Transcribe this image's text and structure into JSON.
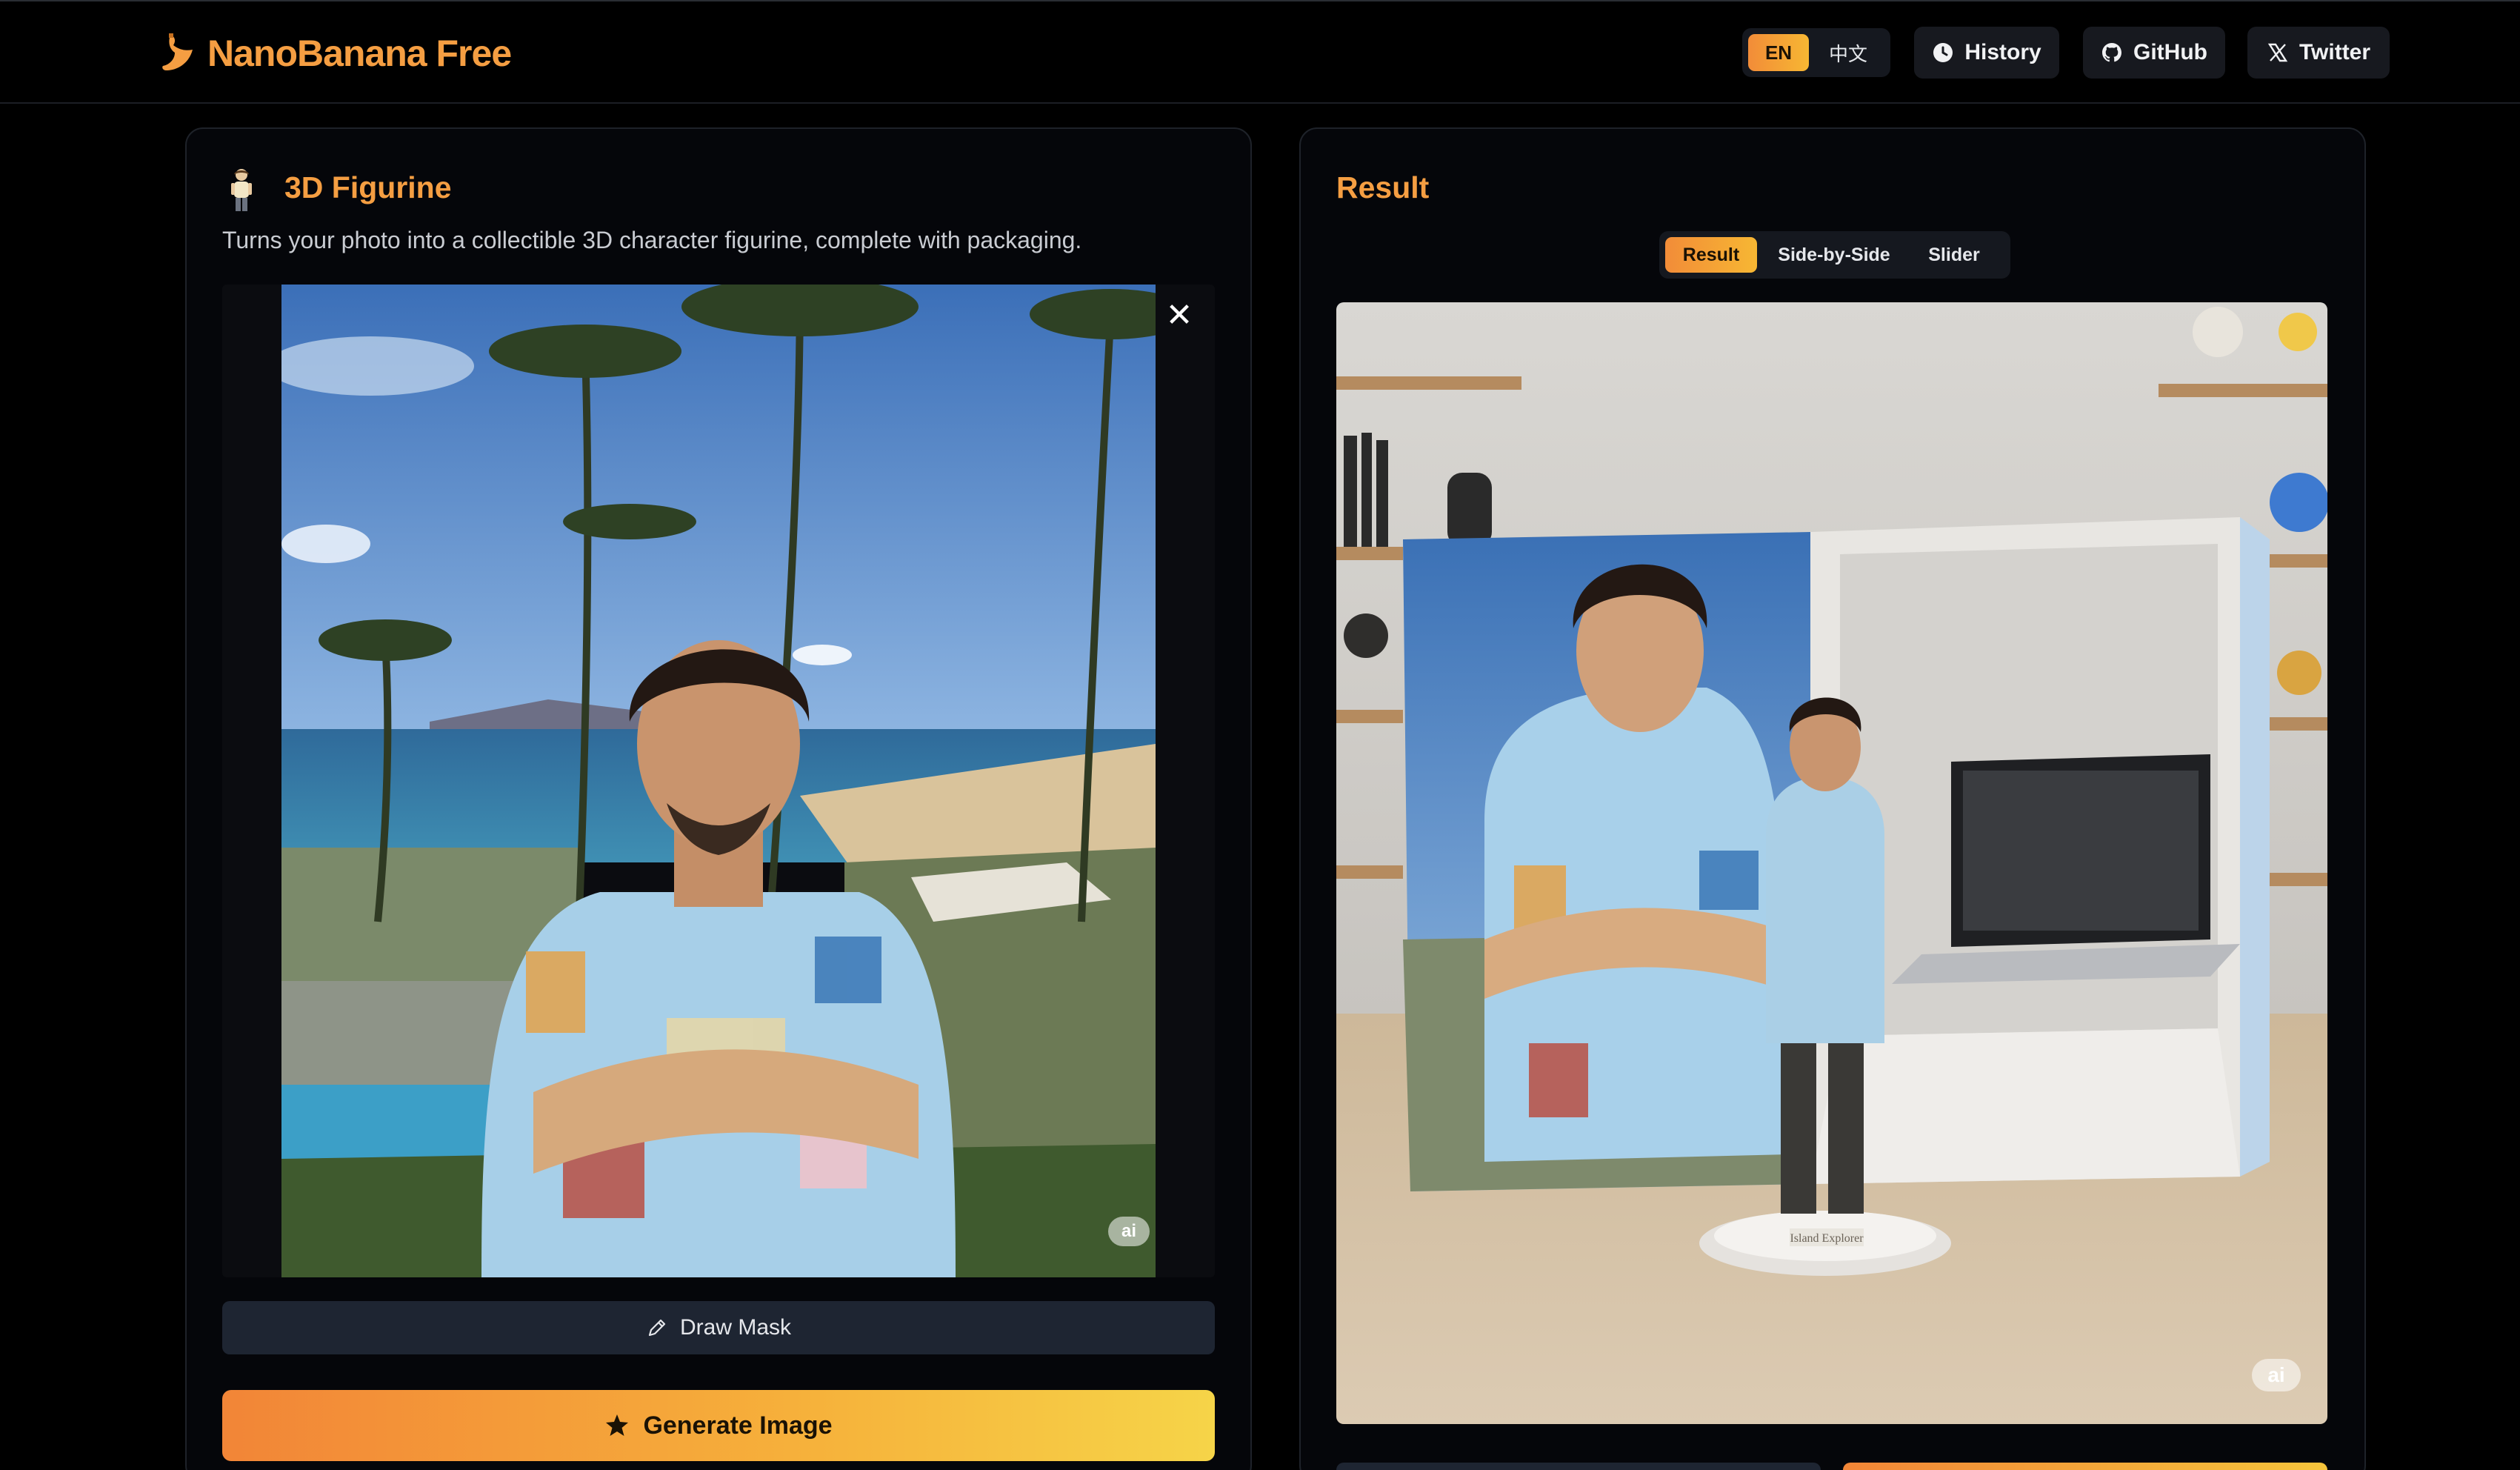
{
  "header": {
    "brand": "NanoBanana Free",
    "lang_active": "EN",
    "lang_other": "中文",
    "history_label": "History",
    "github_label": "GitHub",
    "twitter_label": "Twitter"
  },
  "transform": {
    "title": "3D Figurine",
    "description": "Turns your photo into a collectible 3D character figurine, complete with packaging.",
    "draw_mask_label": "Draw Mask",
    "generate_label": "Generate Image",
    "close_symbol": "✕",
    "watermark": "ai"
  },
  "result": {
    "title": "Result",
    "tabs": [
      {
        "label": "Result",
        "active": true
      },
      {
        "label": "Side-by-Side",
        "active": false
      },
      {
        "label": "Slider",
        "active": false
      }
    ],
    "stand_plaque": "Island Explorer",
    "watermark": "ai"
  },
  "colors": {
    "accent": "#f59e42",
    "gradient_start": "#f28537",
    "gradient_end": "#f6d448",
    "card_bg": "#05060a",
    "button_dark": "#1e2532"
  },
  "icons": [
    "banana-logo-icon",
    "clock-icon",
    "github-icon",
    "x-logo-icon",
    "figurine-icon",
    "close-icon",
    "pencil-icon",
    "star-icon"
  ]
}
